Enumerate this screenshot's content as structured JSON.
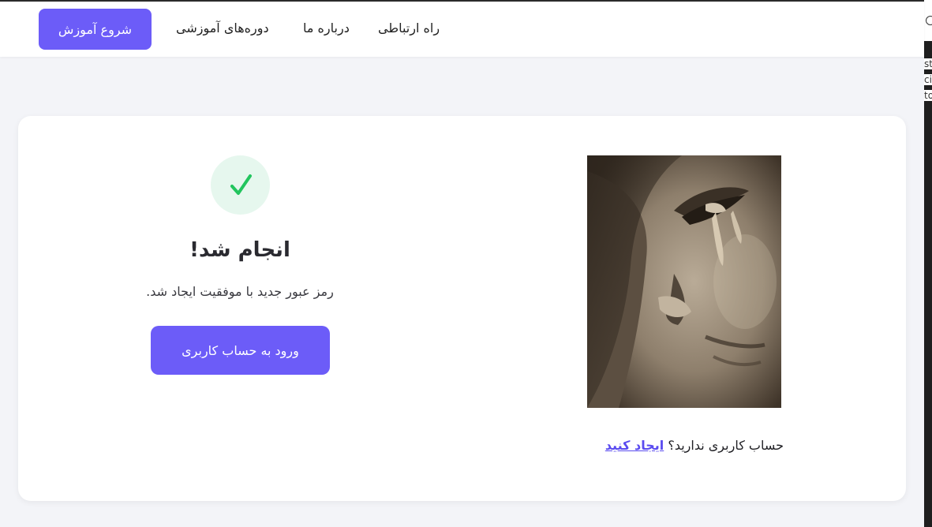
{
  "navbar": {
    "start_button": "شروع آموزش",
    "links": [
      "دوره‌های آموزشی",
      "درباره ما",
      "راه ارتباطی"
    ]
  },
  "success": {
    "title": "انجام شد!",
    "message": "رمز عبور جدید با موفقیت ایجاد شد.",
    "login_button": "ورود به حساب کاربری"
  },
  "signup": {
    "prompt": "حساب کاربری ندارید؟",
    "link": "ایجاد کنید"
  },
  "side_panel": {
    "glyphs": [
      "st",
      "ci",
      "to"
    ]
  },
  "colors": {
    "accent": "#6c5cf8",
    "check": "#22c55e",
    "check_bg": "#e6f7ee",
    "page_bg": "#f3f4f8"
  },
  "icons": {
    "success": "check-icon",
    "side": "circle-icon"
  }
}
